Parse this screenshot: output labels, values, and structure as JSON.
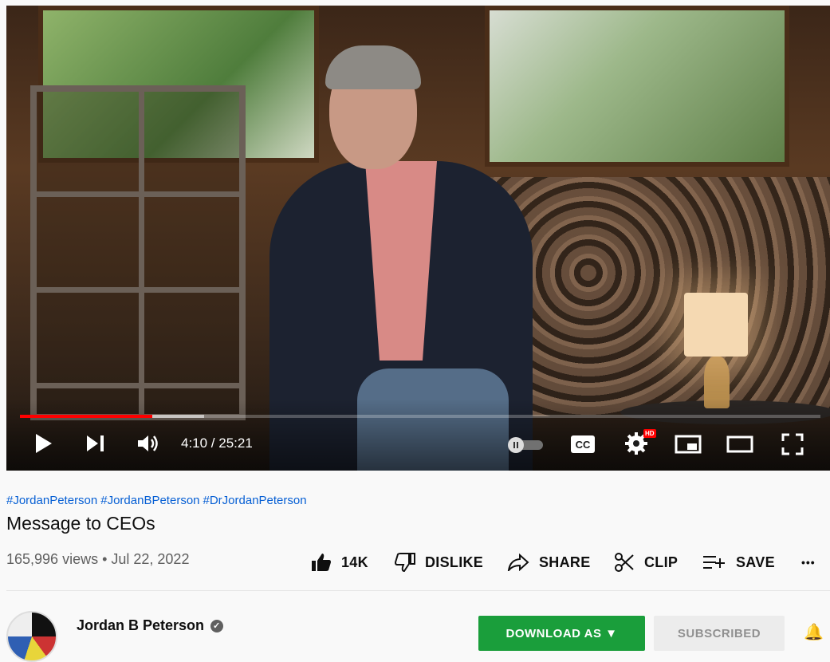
{
  "player": {
    "time_display": "4:10 / 25:21",
    "played_fraction": 0.165,
    "buffered_fraction": 0.23,
    "hd_badge": "HD",
    "cc_label": "CC",
    "icons": [
      "play-icon",
      "next-icon",
      "volume-icon",
      "autoplay-toggle",
      "cc-icon",
      "settings-icon",
      "miniplayer-icon",
      "theater-icon",
      "fullscreen-icon"
    ]
  },
  "video": {
    "hashtags": [
      "#JordanPeterson",
      "#JordanBPeterson",
      "#DrJordanPeterson"
    ],
    "title": "Message to CEOs",
    "views_date": "165,996 views • Jul 22, 2022"
  },
  "actions": {
    "like": "14K",
    "dislike": "DISLIKE",
    "share": "SHARE",
    "clip": "CLIP",
    "save": "SAVE",
    "more": "•••"
  },
  "channel": {
    "name": "Jordan B Peterson",
    "download_label": "DOWNLOAD AS ▼",
    "subscribe_label": "SUBSCRIBED"
  },
  "colors": {
    "progress": "#ff0000",
    "link": "#065fd4",
    "download": "#1a9e3b"
  }
}
